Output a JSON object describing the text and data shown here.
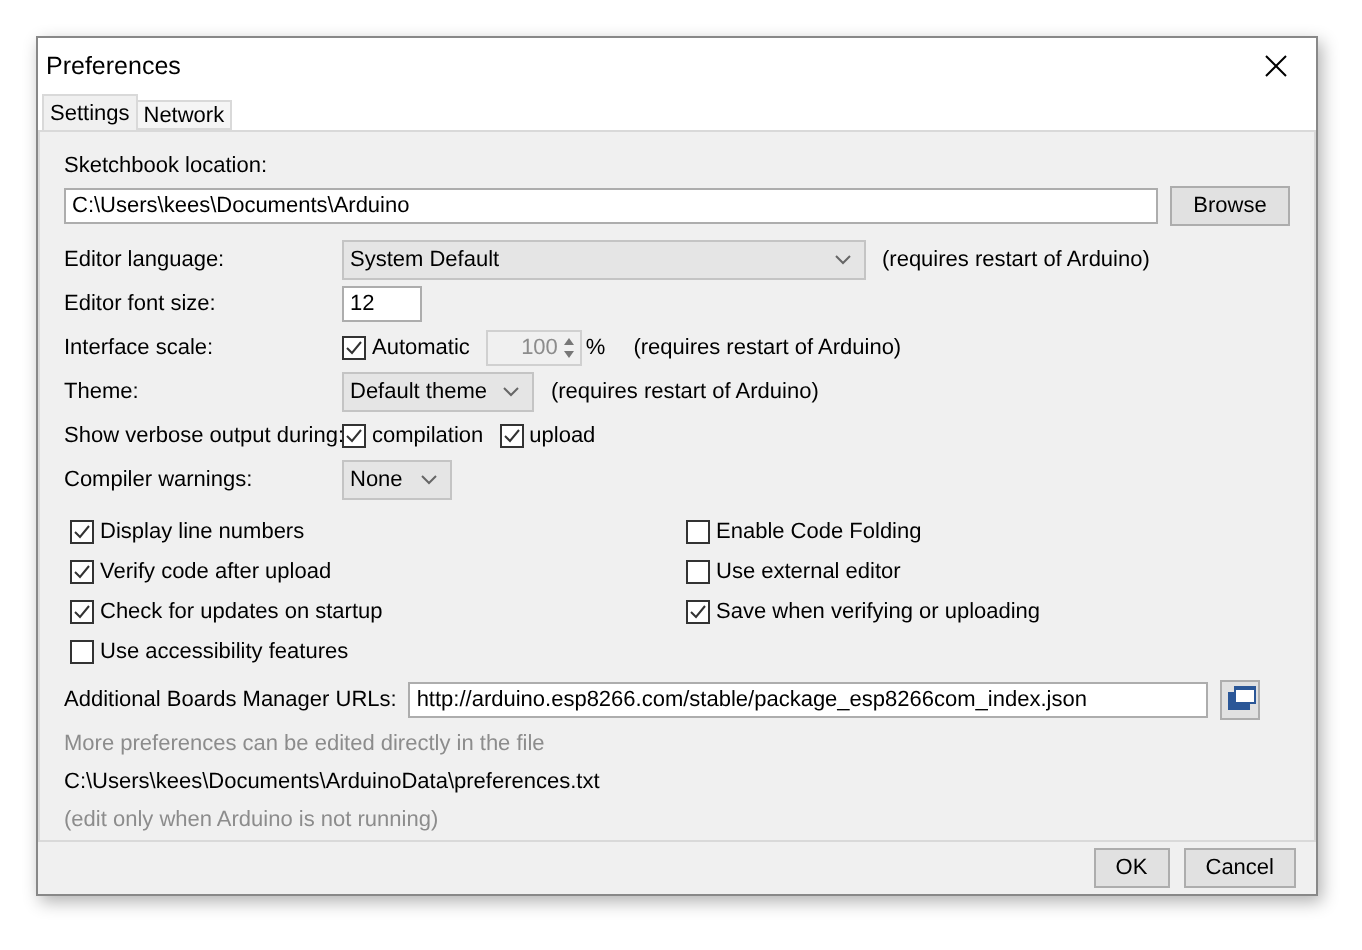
{
  "window": {
    "title": "Preferences"
  },
  "tabs": [
    {
      "label": "Settings",
      "selected": true
    },
    {
      "label": "Network",
      "selected": false
    }
  ],
  "sketchbook": {
    "label": "Sketchbook location:",
    "value": "C:\\Users\\kees\\Documents\\Arduino",
    "button": "Browse"
  },
  "rows": [
    {
      "kind": "select",
      "label": "Editor language:",
      "value": "System Default",
      "note": "(requires restart of Arduino)"
    },
    {
      "kind": "text",
      "label": "Editor font size:",
      "value": "12"
    },
    {
      "kind": "scale",
      "label": "Interface scale:",
      "option": {
        "label": "Automatic",
        "checked": true
      },
      "spinner": {
        "value": "100",
        "disabled": true
      },
      "unit": "%",
      "note": "(requires restart of Arduino)"
    },
    {
      "kind": "select",
      "label": "Theme:",
      "value": "Default theme",
      "note": "(requires restart of Arduino)"
    },
    {
      "kind": "checks",
      "label": "Show verbose output during:",
      "options": [
        {
          "label": "compilation",
          "checked": true
        },
        {
          "label": "upload",
          "checked": true
        }
      ]
    },
    {
      "kind": "select",
      "label": "Compiler warnings:",
      "value": "None"
    }
  ],
  "options_left": [
    {
      "label": "Display line numbers",
      "checked": true
    },
    {
      "label": "Verify code after upload",
      "checked": true
    },
    {
      "label": "Check for updates on startup",
      "checked": true
    },
    {
      "label": "Use accessibility features",
      "checked": false
    }
  ],
  "options_right": [
    {
      "label": "Enable Code Folding",
      "checked": false
    },
    {
      "label": "Use external editor",
      "checked": false
    },
    {
      "label": "Save when verifying or uploading",
      "checked": true
    }
  ],
  "boards_urls": {
    "label": "Additional Boards Manager URLs:",
    "value": "http://arduino.esp8266.com/stable/package_esp8266com_index.json"
  },
  "notes": [
    {
      "kind": "hint",
      "text": "More preferences can be edited directly in the file"
    },
    {
      "kind": "path",
      "text": "C:\\Users\\kees\\Documents\\ArduinoData\\preferences.txt"
    },
    {
      "kind": "hint",
      "text": "(edit only when Arduino is not running)"
    }
  ],
  "buttons": [
    "OK",
    "Cancel"
  ]
}
